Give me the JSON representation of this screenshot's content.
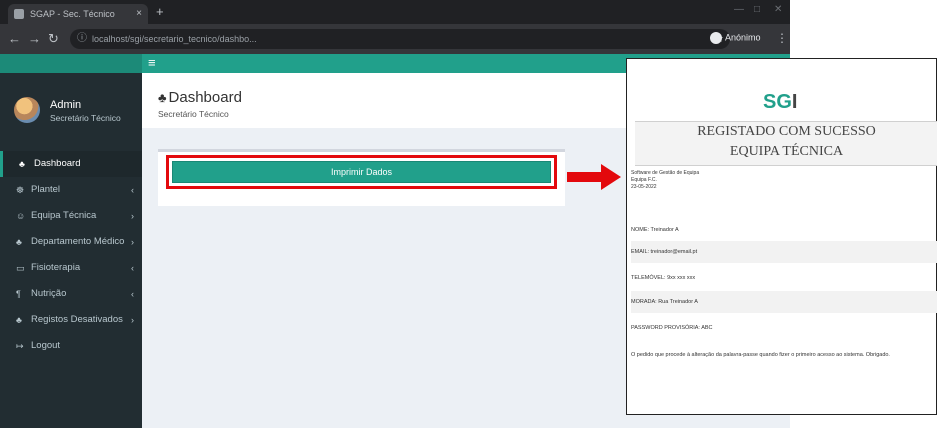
{
  "browser": {
    "tab_title": "SGAP - Sec. Técnico",
    "tab_close": "×",
    "new_tab": "+",
    "url": "localhost/sgi/secretario_tecnico/dashbo...",
    "profile": "Anónimo"
  },
  "app": {
    "hamburger": "≡",
    "user": {
      "name": "Admin",
      "role": "Secretário Técnico"
    },
    "menu": [
      {
        "icon": "♣",
        "label": "Dashboard",
        "active": true,
        "chevron": ""
      },
      {
        "icon": "☸",
        "label": "Plantel",
        "chevron": "‹"
      },
      {
        "icon": "☺",
        "label": "Equipa Técnica",
        "chevron": "›"
      },
      {
        "icon": "♣",
        "label": "Departamento Médico",
        "chevron": "›"
      },
      {
        "icon": "▭",
        "label": "Fisioterapia",
        "chevron": "‹"
      },
      {
        "icon": "¶",
        "label": "Nutrição",
        "chevron": "‹"
      },
      {
        "icon": "♣",
        "label": "Registos Desativados",
        "chevron": "›"
      },
      {
        "icon": "↦",
        "label": "Logout",
        "chevron": ""
      }
    ],
    "header": {
      "title": "Dashboard",
      "subtitle": "Secretário Técnico"
    },
    "print_button": "Imprimir Dados"
  },
  "document": {
    "logo_a": "SG",
    "logo_b": "I",
    "title_line1": "REGISTADO COM SUCESSO",
    "title_line2": "EQUIPA TÉCNICA",
    "org_lines": [
      "Software de Gestão de Equipa",
      "Equipa F.C.",
      "23-05-2022"
    ],
    "fields": [
      "NOME: Treinador A",
      "EMAIL: treinador@email.pt",
      "TELEMÓVEL: 9xx xxx xxx",
      "MORADA: Rua Treinador A",
      "PASSWORD PROVISÓRIA: ABC"
    ],
    "footer": "O pedido que procede à alteração da palavra-passe quando fizer o primeiro acesso ao sistema. Obrigado."
  },
  "colors": {
    "accent": "#21a08b",
    "highlight": "#e3090d",
    "sidebar": "#222d32"
  }
}
